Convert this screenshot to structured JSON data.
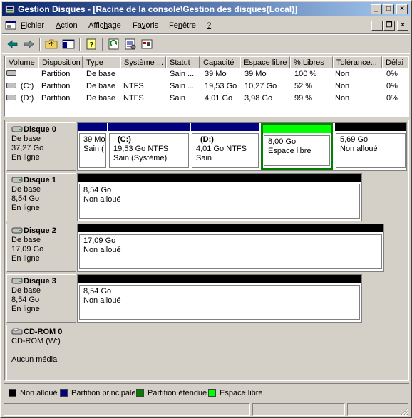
{
  "window": {
    "title": "Gestion Disques - [Racine de la console\\Gestion des disques(Local)]",
    "buttons": {
      "minimize": "_",
      "maximize": "□",
      "close": "×"
    },
    "mdi_buttons": {
      "minimize": "_",
      "restore": "❐",
      "close": "×"
    }
  },
  "menu": [
    {
      "label": "Fichier",
      "key": "F",
      "rest": "ichier"
    },
    {
      "label": "Action",
      "key": "A",
      "rest": "ction"
    },
    {
      "label": "Affichage",
      "pre": "Affic",
      "key": "h",
      "rest": "age"
    },
    {
      "label": "Favoris",
      "pre": "Fa",
      "key": "v",
      "rest": "oris"
    },
    {
      "label": "Fenêtre",
      "pre": "Fe",
      "key": "n",
      "rest": "être"
    },
    {
      "label": "?",
      "key": "?",
      "rest": ""
    }
  ],
  "volumes": {
    "headers": [
      "Volume",
      "Disposition",
      "Type",
      "Système ...",
      "Statut",
      "Capacité",
      "Espace libre",
      "% Libres",
      "Tolérance...",
      "Délai"
    ],
    "rows": [
      {
        "volume": "",
        "disposition": "Partition",
        "type": "De base",
        "fs": "",
        "status": "Sain ...",
        "capacity": "39 Mo",
        "free": "39 Mo",
        "pct": "100 %",
        "tolerance": "Non",
        "delay": "0%"
      },
      {
        "volume": "(C:)",
        "disposition": "Partition",
        "type": "De base",
        "fs": "NTFS",
        "status": "Sain ...",
        "capacity": "19,53 Go",
        "free": "10,27 Go",
        "pct": "52 %",
        "tolerance": "Non",
        "delay": "0%"
      },
      {
        "volume": "(D:)",
        "disposition": "Partition",
        "type": "De base",
        "fs": "NTFS",
        "status": "Sain",
        "capacity": "4,01 Go",
        "free": "3,98 Go",
        "pct": "99 %",
        "tolerance": "Non",
        "delay": "0%"
      }
    ]
  },
  "disks": [
    {
      "name": "Disque 0",
      "type": "De base",
      "size": "37,27 Go",
      "state": "En ligne",
      "partitions": [
        {
          "title": "",
          "line1": "39 Mo",
          "line2": "Sain (",
          "color": "#000080"
        },
        {
          "title": "(C:)",
          "line1": "19,53 Go NTFS",
          "line2": "Sain (Système)",
          "color": "#000080"
        },
        {
          "title": "(D:)",
          "line1": "4,01 Go NTFS",
          "line2": "Sain",
          "color": "#000080"
        },
        {
          "title": "",
          "line1": "8,00 Go",
          "line2": "Espace libre",
          "color": "#00ff00"
        },
        {
          "title": "",
          "line1": "5,69 Go",
          "line2": "Non alloué",
          "color": "#000000"
        }
      ]
    },
    {
      "name": "Disque 1",
      "type": "De base",
      "size": "8,54 Go",
      "state": "En ligne",
      "partitions": [
        {
          "line1": "8,54 Go",
          "line2": "Non alloué",
          "color": "#000000"
        }
      ]
    },
    {
      "name": "Disque 2",
      "type": "De base",
      "size": "17,09 Go",
      "state": "En ligne",
      "partitions": [
        {
          "line1": "17,09 Go",
          "line2": "Non alloué",
          "color": "#000000"
        }
      ]
    },
    {
      "name": "Disque 3",
      "type": "De base",
      "size": "8,54 Go",
      "state": "En ligne",
      "partitions": [
        {
          "line1": "8,54 Go",
          "line2": "Non alloué",
          "color": "#000000"
        }
      ]
    }
  ],
  "cdrom": {
    "name": "CD-ROM 0",
    "drive": "CD-ROM (W:)",
    "media": "Aucun média"
  },
  "legend": [
    {
      "label": "Non alloué",
      "color": "#000000"
    },
    {
      "label": "Partition principale",
      "color": "#000080"
    },
    {
      "label": "Partition étendue",
      "color": "#008000"
    },
    {
      "label": "Espace libre",
      "color": "#00ff00"
    }
  ]
}
